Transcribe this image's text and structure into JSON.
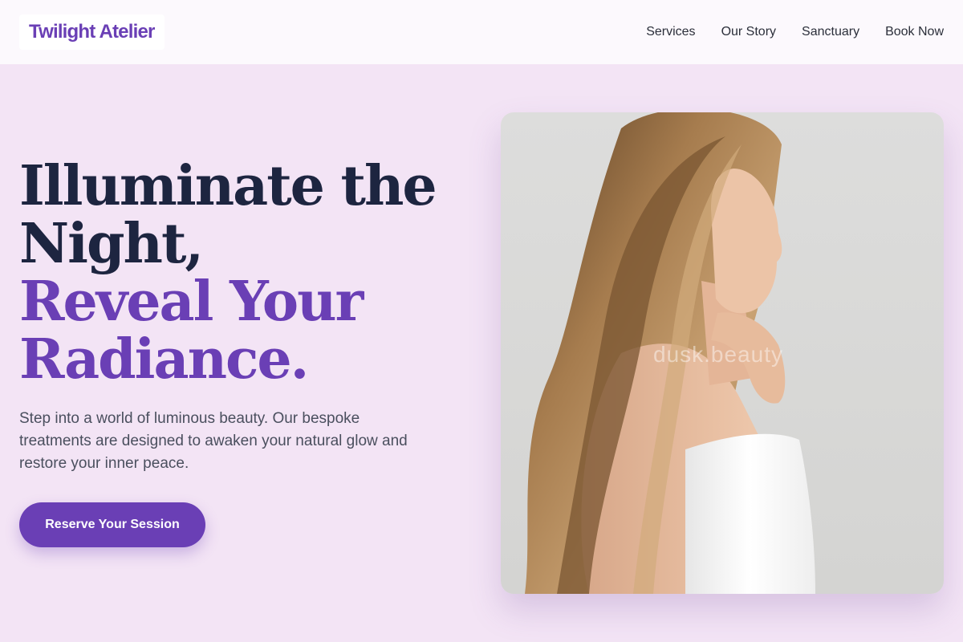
{
  "header": {
    "logo": "Twilight Atelier",
    "nav": [
      "Services",
      "Our Story",
      "Sanctuary",
      "Book Now"
    ]
  },
  "hero": {
    "headline_line1": "Illuminate the",
    "headline_line2": "Night,",
    "headline_line3": "Reveal Your",
    "headline_line4": "Radiance.",
    "subtitle": "Step into a world of luminous beauty. Our bespoke treatments are designed to awaken your natural glow and restore your inner peace.",
    "cta_label": "Reserve Your Session"
  },
  "photo": {
    "watermark": "dusk.beauty"
  },
  "colors": {
    "accent": "#6a3fb5",
    "background": "#f3e4f5",
    "header_bg": "#fcf9fd",
    "headline_dark": "#1d2540"
  }
}
